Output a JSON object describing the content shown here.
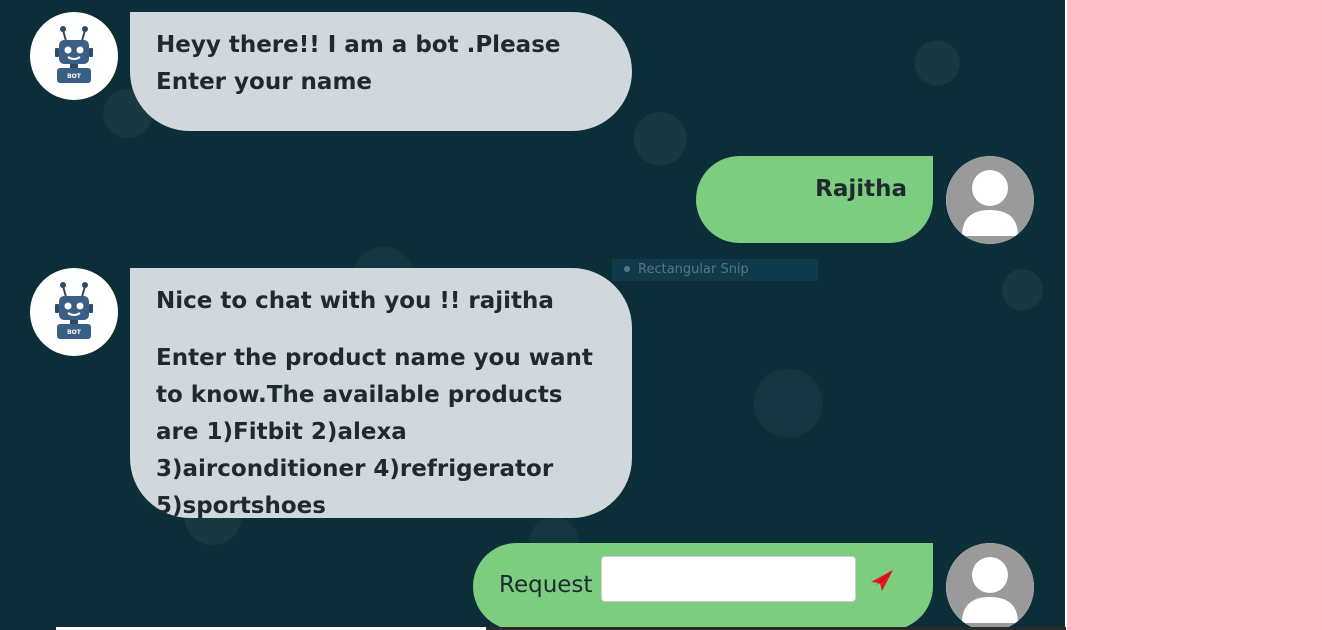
{
  "colors": {
    "chat_background": "#0b2e38",
    "side_panel": "#ffc0cb",
    "bot_bubble": "#d1d8dc",
    "user_bubble": "#7ccd7f",
    "send_icon": "#e3161f"
  },
  "messages": [
    {
      "sender": "bot",
      "avatar_icon": "robot-icon",
      "text": "Heyy there!! I am a bot .Please Enter your name"
    },
    {
      "sender": "user",
      "avatar_icon": "user-icon",
      "text": "Rajitha"
    },
    {
      "sender": "bot",
      "avatar_icon": "robot-icon",
      "lines": [
        "Nice to chat with you !! rajitha",
        "Enter the product name you want to know.The available products are 1)Fitbit 2)alexa 3)airconditioner 4)refrigerator 5)sportshoes"
      ]
    }
  ],
  "composer": {
    "label": "Request",
    "value": "",
    "send_icon": "send-icon",
    "avatar_icon": "user-icon"
  },
  "overlay": {
    "text": "Rectangular Snip"
  },
  "robot_badge_text": "BOT"
}
